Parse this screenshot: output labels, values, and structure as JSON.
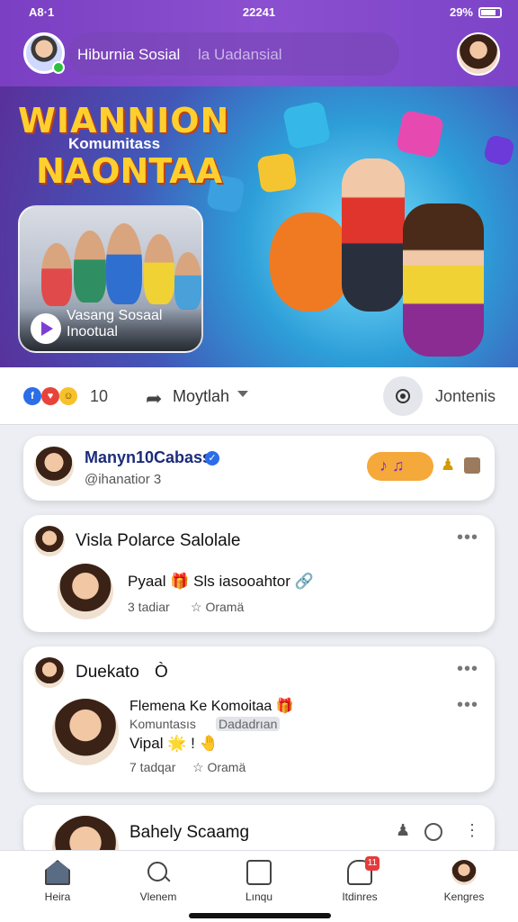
{
  "status_bar": {
    "left": "A8·1",
    "time": "22241",
    "battery": "29%"
  },
  "header": {
    "search_title": "Hiburnia Sosial",
    "search_hint": "la Uadansial"
  },
  "banner": {
    "title_top": "WIANNION",
    "subtitle": "Komumitass",
    "title_bottom": "NAONTAA",
    "photo_label": "Vasang Sosaal Inootual"
  },
  "actions": {
    "reaction_count": "10",
    "share_label": "Moytlah",
    "content_label": "Jontenis"
  },
  "cards": [
    {
      "name": "Manyn10Cabass",
      "handle": "@ihanatior 3",
      "pill_icons": "♪ ♫"
    },
    {
      "title": "Visla Polarce Salolale",
      "comment_text": "Pyaal 🎁 Sls iasooahtor 🔗",
      "meta_time": "3 tadiar",
      "meta_action": "☆ Oramä"
    },
    {
      "title": "Duekato",
      "title_suffix": "Ò",
      "line1": "Flemena Ke Komoitaa 🎁",
      "line2a": "Komuntasıs",
      "line2b": "Dadadrıan",
      "line3": "Vipal 🌟 ! 🤚",
      "meta_time": "7 tadqar",
      "meta_action": "☆ Oramä"
    },
    {
      "title": "Bahely Scaamg"
    }
  ],
  "nav": [
    {
      "label": "Heira",
      "icon": "home-icon"
    },
    {
      "label": "Vlenem",
      "icon": "search-icon"
    },
    {
      "label": "Lınqu",
      "icon": "box-icon"
    },
    {
      "label": "Itdinres",
      "icon": "notifications-icon",
      "badge": "11"
    },
    {
      "label": "Kengres",
      "icon": "profile-avatar"
    }
  ],
  "colors": {
    "header_purple": "#7a3fc2",
    "accent_blue": "#2c6de8",
    "badge_red": "#e53b3b",
    "pill_orange": "#f5a93a"
  }
}
